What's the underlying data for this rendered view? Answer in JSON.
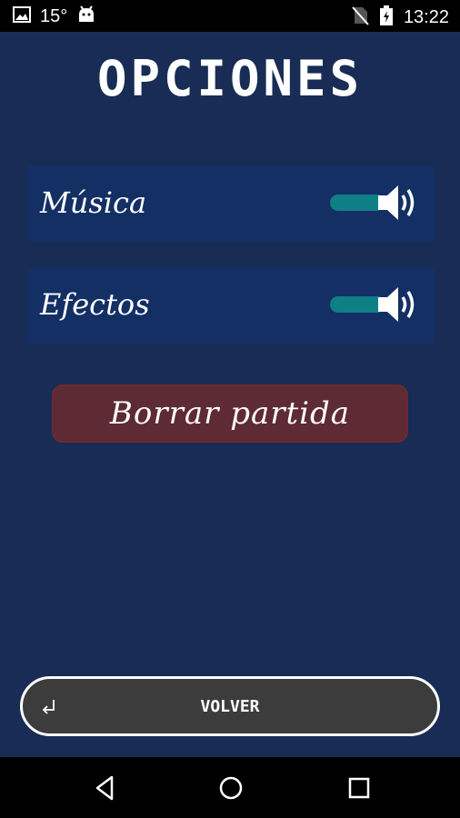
{
  "status_bar": {
    "temperature": "15°",
    "time": "13:22",
    "icons": [
      "image-icon",
      "android-icon",
      "no-sim-icon",
      "battery-charging-icon"
    ]
  },
  "screen": {
    "title": "OPCIONES",
    "options": [
      {
        "label": "Música",
        "enabled": true,
        "icon": "speaker-icon"
      },
      {
        "label": "Efectos",
        "enabled": true,
        "icon": "speaker-icon"
      }
    ],
    "delete_button": "Borrar partida",
    "back_button": "VOLVER"
  },
  "nav_bar": {
    "icons": [
      "back-triangle-icon",
      "home-circle-icon",
      "recents-square-icon"
    ]
  },
  "colors": {
    "background": "#182c55",
    "row_background": "#132f64",
    "toggle_on": "#0f7f86",
    "delete_button": "#5e2a33",
    "back_button": "#3c3c3c"
  }
}
